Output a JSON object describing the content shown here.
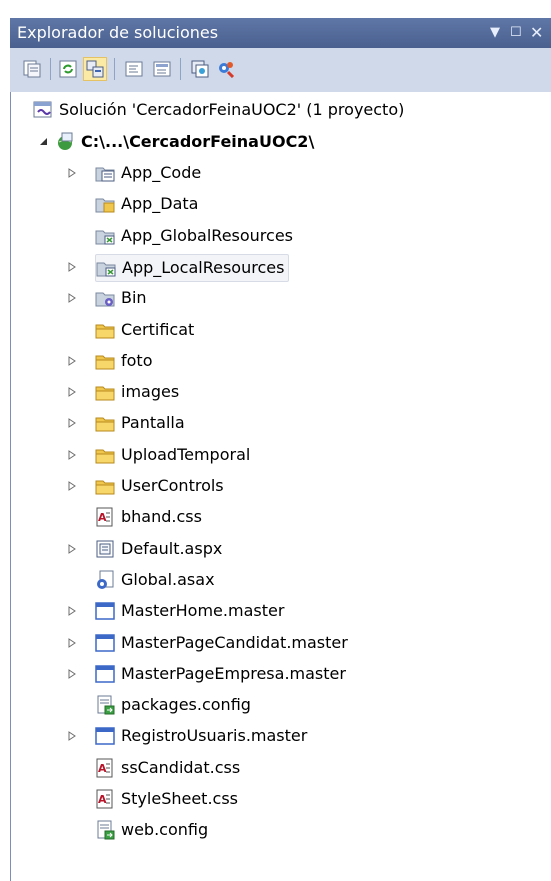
{
  "window": {
    "title": "Explorador de soluciones"
  },
  "toolbar": {
    "buttons": [
      {
        "name": "properties-icon"
      },
      {
        "name": "refresh-icon"
      },
      {
        "name": "nest-related-files-icon"
      },
      {
        "name": "view-code-icon"
      },
      {
        "name": "view-designer-icon"
      },
      {
        "name": "copy-website-icon"
      },
      {
        "name": "asp-net-configuration-icon"
      }
    ]
  },
  "tree": {
    "solution": "Solución 'CercadorFeinaUOC2'  (1 proyecto)",
    "project": "C:\\...\\CercadorFeinaUOC2\\",
    "items": [
      {
        "label": "App_Code",
        "icon": "code-folder",
        "expandable": true
      },
      {
        "label": "App_Data",
        "icon": "data-folder",
        "expandable": false
      },
      {
        "label": "App_GlobalResources",
        "icon": "resources-folder",
        "expandable": false
      },
      {
        "label": "App_LocalResources",
        "icon": "resources-folder",
        "expandable": true,
        "selected": true
      },
      {
        "label": "Bin",
        "icon": "bin-folder",
        "expandable": true
      },
      {
        "label": "Certificat",
        "icon": "folder",
        "expandable": false
      },
      {
        "label": "foto",
        "icon": "folder",
        "expandable": true
      },
      {
        "label": "images",
        "icon": "folder",
        "expandable": true
      },
      {
        "label": "Pantalla",
        "icon": "folder",
        "expandable": true
      },
      {
        "label": "UploadTemporal",
        "icon": "folder",
        "expandable": true
      },
      {
        "label": "UserControls",
        "icon": "folder",
        "expandable": true
      },
      {
        "label": "bhand.css",
        "icon": "css-file",
        "expandable": false
      },
      {
        "label": "Default.aspx",
        "icon": "aspx-file",
        "expandable": true
      },
      {
        "label": "Global.asax",
        "icon": "asax-file",
        "expandable": false
      },
      {
        "label": "MasterHome.master",
        "icon": "master-file",
        "expandable": true
      },
      {
        "label": "MasterPageCandidat.master",
        "icon": "master-file",
        "expandable": true
      },
      {
        "label": "MasterPageEmpresa.master",
        "icon": "master-file",
        "expandable": true
      },
      {
        "label": "packages.config",
        "icon": "config-file",
        "expandable": false
      },
      {
        "label": "RegistroUsuaris.master",
        "icon": "master-file",
        "expandable": true
      },
      {
        "label": "ssCandidat.css",
        "icon": "css-file",
        "expandable": false
      },
      {
        "label": "StyleSheet.css",
        "icon": "css-file",
        "expandable": false
      },
      {
        "label": "web.config",
        "icon": "config-file",
        "expandable": false
      }
    ]
  },
  "colors": {
    "title_bar": "#4f6797",
    "toolbar_bg": "#cfd9ea",
    "folder": "#f0c64c",
    "selected_bg": "#f3f4f8"
  }
}
